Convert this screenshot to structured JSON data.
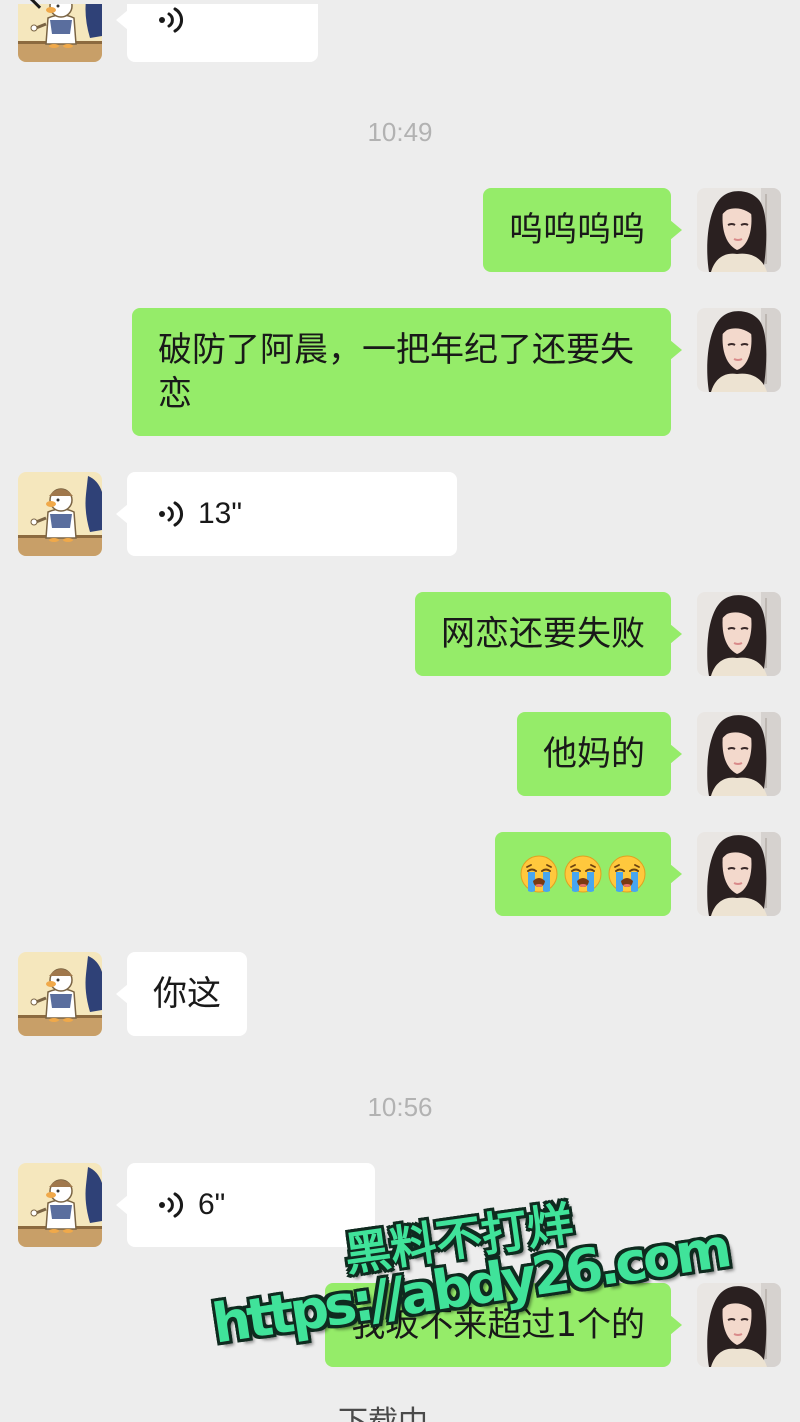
{
  "chat": {
    "icons": {
      "back": "chevron-left-icon",
      "contact_avatar": "duck-cartoon-avatar-icon",
      "self_avatar": "girl-photo-avatar-icon",
      "voice": "voice-wave-icon"
    },
    "timestamps": [
      "10:49",
      "10:56"
    ],
    "messages": [
      {
        "voice_icon": "voice-wave-icon"
      },
      {
        "text": "呜呜呜呜"
      },
      {
        "text": "破防了阿晨，一把年纪了还要失恋"
      },
      {
        "voice_icon": "voice-wave-icon",
        "duration": "13\""
      },
      {
        "text": "网恋还要失败"
      },
      {
        "text": "他妈的"
      },
      {
        "emoji": [
          "loudly-crying-face-icon",
          "loudly-crying-face-icon",
          "loudly-crying-face-icon"
        ]
      },
      {
        "text": "你这"
      },
      {
        "voice_icon": "voice-wave-icon",
        "duration": "6\""
      },
      {
        "text": "我坂不来超过1个的"
      }
    ],
    "footer": {
      "status": "下载中"
    }
  },
  "watermark": {
    "line1": "黑料不打烊",
    "line2": "https://abdy26.com"
  },
  "colors": {
    "background": "#ededed",
    "outgoing_bubble": "#95ec69",
    "incoming_bubble": "#ffffff",
    "timestamp_text": "#b2b2b2",
    "watermark_fill": "#40e39a",
    "watermark_outline": "#0f2a1f"
  }
}
